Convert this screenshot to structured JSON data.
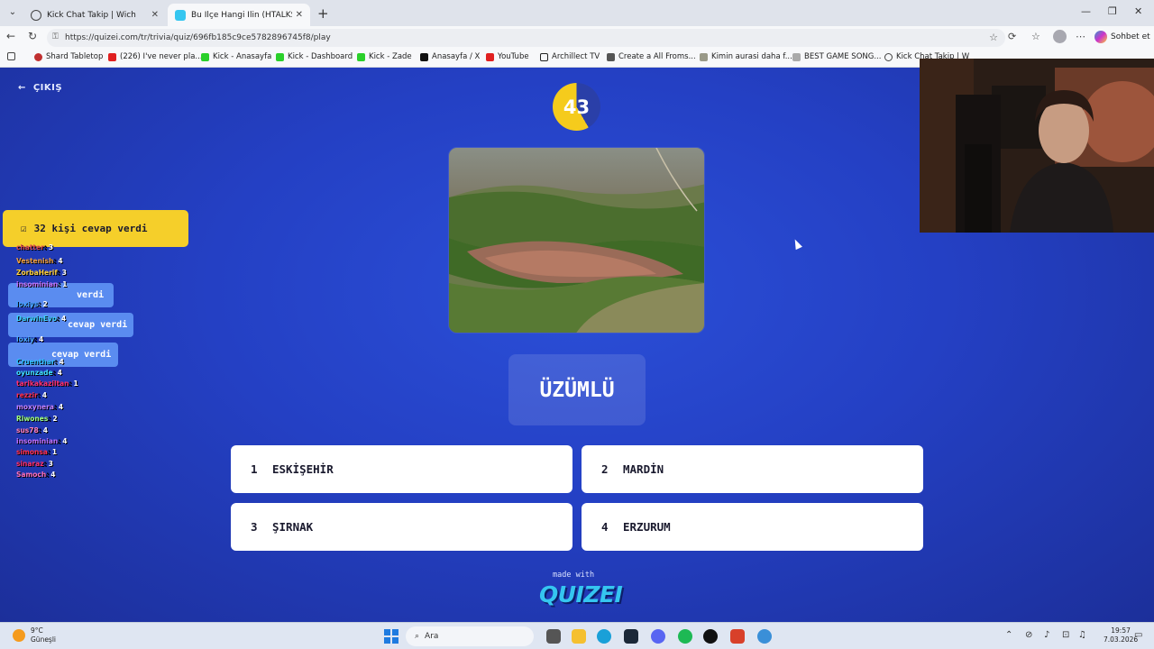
{
  "browser": {
    "tabs": [
      {
        "title": "Kick Chat Takip | Wich",
        "active": false
      },
      {
        "title": "Bu İlçe Hangi İlin (HTALKS ÖZEL) -",
        "active": true
      }
    ],
    "url": "https://quizei.com/tr/trivia/quiz/696fb185c9ce5782896745f8/play",
    "chat_button": "Sohbet et",
    "bookmarks": [
      "Shard Tabletop",
      "(226) I've never pla...",
      "Kick - Anasayfa",
      "Kick - Dashboard",
      "Kick - Zade",
      "Anasayfa / X",
      "YouTube",
      "Archillect TV",
      "Create a All Froms...",
      "Kimin aurasi daha f...",
      "BEST GAME SONG...",
      "Kick Chat Takip | W"
    ]
  },
  "quiz": {
    "exit_label": "ÇIKIŞ",
    "timer": "43",
    "timer_remaining_fraction": 0.58,
    "question": "ÜZÜMLÜ",
    "answers": [
      {
        "num": "1",
        "label": "ESKİŞEHİR"
      },
      {
        "num": "2",
        "label": "MARDİN"
      },
      {
        "num": "3",
        "label": "ŞIRNAK"
      },
      {
        "num": "4",
        "label": "ERZURUM"
      }
    ],
    "made_with": "made with",
    "brand": "QUIZEI"
  },
  "overlay": {
    "answered_count": "32 kişi cevap verdi",
    "answer_notifs": [
      "verdi",
      "cevap verdi",
      "cevap verdi"
    ],
    "chat": [
      {
        "name": "chatter",
        "count": "3",
        "color": "#e05050"
      },
      {
        "name": "Vestenish",
        "count": "4",
        "color": "#f0a040"
      },
      {
        "name": "ZorbaHerif",
        "count": "3",
        "color": "#ffd040"
      },
      {
        "name": "insominian",
        "count": "1",
        "color": "#c070ff"
      },
      {
        "name": "loxiys",
        "count": "2",
        "color": "#40a0ff"
      },
      {
        "name": "DarwinEvo",
        "count": "4",
        "color": "#40d0ff"
      },
      {
        "name": "loxiy",
        "count": "4",
        "color": "#50b0ff"
      },
      {
        "name": "Cruenthar",
        "count": "4",
        "color": "#30c0ff"
      },
      {
        "name": "oyunzade",
        "count": "4",
        "color": "#40e0ff"
      },
      {
        "name": "tarikakaziltan",
        "count": "1",
        "color": "#ff3070"
      },
      {
        "name": "rezzir",
        "count": "4",
        "color": "#ff3050"
      },
      {
        "name": "moxynera",
        "count": "4",
        "color": "#c080ff"
      },
      {
        "name": "Riwones",
        "count": "2",
        "color": "#a0ff80"
      },
      {
        "name": "sus78",
        "count": "4",
        "color": "#ff80c0"
      },
      {
        "name": "insominian",
        "count": "4",
        "color": "#c070ff"
      },
      {
        "name": "simonsa",
        "count": "1",
        "color": "#ff3050"
      },
      {
        "name": "sinaraz",
        "count": "3",
        "color": "#ff3070"
      },
      {
        "name": "Samoch",
        "count": "4",
        "color": "#ff70c0"
      }
    ]
  },
  "taskbar": {
    "weather_temp": "9°C",
    "weather_desc": "Güneşli",
    "search_placeholder": "Ara",
    "time": "19:57",
    "date": "7.03.2026"
  }
}
